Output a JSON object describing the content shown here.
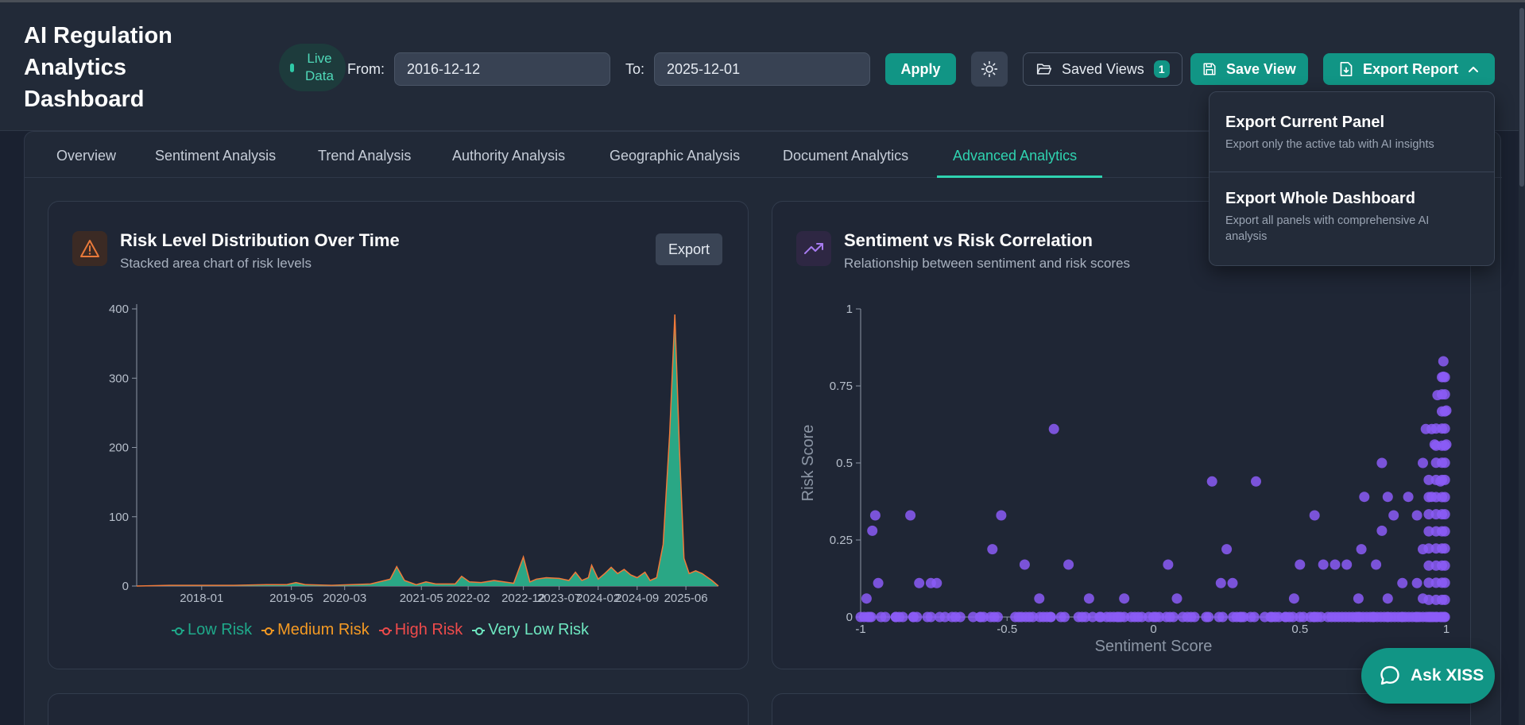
{
  "header": {
    "title": "AI Regulation Analytics Dashboard",
    "live_label": "Live Data",
    "from_label": "From:",
    "from_value": "2016-12-12",
    "to_label": "To:",
    "to_value": "2025-12-01",
    "apply_label": "Apply",
    "saved_views_label": "Saved Views",
    "saved_views_count": "1",
    "save_view_label": "Save View",
    "export_report_label": "Export Report"
  },
  "tabs": [
    {
      "label": "Overview"
    },
    {
      "label": "Sentiment Analysis"
    },
    {
      "label": "Trend Analysis"
    },
    {
      "label": "Authority Analysis"
    },
    {
      "label": "Geographic Analysis"
    },
    {
      "label": "Document Analytics"
    },
    {
      "label": "Advanced Analytics",
      "active": true
    }
  ],
  "export_menu": {
    "current_title": "Export Current Panel",
    "current_desc": "Export only the active tab with AI insights",
    "whole_title": "Export Whole Dashboard",
    "whole_desc": "Export all panels with comprehensive AI analysis"
  },
  "panels": {
    "risk": {
      "title": "Risk Level Distribution Over Time",
      "subtitle": "Stacked area chart of risk levels",
      "export_label": "Export",
      "icon": "warning-triangle-icon",
      "accent": "#e8793a"
    },
    "sentiment": {
      "title": "Sentiment vs Risk Correlation",
      "subtitle": "Relationship between sentiment and risk scores",
      "icon": "trending-up-icon",
      "accent": "#a77bf0"
    }
  },
  "ask_label": "Ask XISS",
  "colors": {
    "accent": "#119585",
    "low": "#1fa98a",
    "medium": "#f59a23",
    "high": "#ef4b4b",
    "very_low": "#6ee7c0",
    "scatter": "#8b5cf6"
  },
  "chart_data": [
    {
      "type": "area",
      "stacked": true,
      "x_ticks": [
        "2018-01",
        "2019-05",
        "2020-03",
        "2021-05",
        "2022-02",
        "2022-12",
        "2023-07",
        "2024-02",
        "2024-09",
        "2025-06"
      ],
      "y_ticks": [
        "0",
        "100",
        "200",
        "300",
        "400"
      ],
      "ylim": [
        0,
        400
      ],
      "series": [
        {
          "name": "Low Risk",
          "color": "#1fa98a"
        },
        {
          "name": "Medium Risk",
          "color": "#f59a23"
        },
        {
          "name": "High Risk",
          "color": "#ef4b4b"
        },
        {
          "name": "Very Low Risk",
          "color": "#6ee7c0"
        }
      ],
      "total_by_month": [
        [
          2017.0,
          0
        ],
        [
          2017.5,
          1
        ],
        [
          2018.0,
          1
        ],
        [
          2018.5,
          1
        ],
        [
          2019.0,
          2
        ],
        [
          2019.3,
          2
        ],
        [
          2019.45,
          5
        ],
        [
          2019.6,
          2
        ],
        [
          2020.0,
          1
        ],
        [
          2020.3,
          2
        ],
        [
          2020.6,
          3
        ],
        [
          2020.9,
          10
        ],
        [
          2021.0,
          28
        ],
        [
          2021.12,
          8
        ],
        [
          2021.3,
          2
        ],
        [
          2021.45,
          6
        ],
        [
          2021.6,
          3
        ],
        [
          2021.9,
          3
        ],
        [
          2022.0,
          14
        ],
        [
          2022.12,
          6
        ],
        [
          2022.3,
          5
        ],
        [
          2022.5,
          8
        ],
        [
          2022.65,
          6
        ],
        [
          2022.8,
          4
        ],
        [
          2022.95,
          42
        ],
        [
          2023.05,
          6
        ],
        [
          2023.15,
          10
        ],
        [
          2023.3,
          12
        ],
        [
          2023.5,
          11
        ],
        [
          2023.65,
          8
        ],
        [
          2023.75,
          20
        ],
        [
          2023.85,
          8
        ],
        [
          2023.95,
          12
        ],
        [
          2024.0,
          30
        ],
        [
          2024.1,
          10
        ],
        [
          2024.2,
          18
        ],
        [
          2024.3,
          27
        ],
        [
          2024.4,
          18
        ],
        [
          2024.5,
          24
        ],
        [
          2024.6,
          16
        ],
        [
          2024.7,
          12
        ],
        [
          2024.82,
          20
        ],
        [
          2024.9,
          8
        ],
        [
          2025.0,
          12
        ],
        [
          2025.1,
          60
        ],
        [
          2025.2,
          220
        ],
        [
          2025.28,
          392
        ],
        [
          2025.35,
          200
        ],
        [
          2025.42,
          40
        ],
        [
          2025.5,
          18
        ],
        [
          2025.6,
          22
        ],
        [
          2025.7,
          18
        ],
        [
          2025.85,
          8
        ],
        [
          2025.95,
          0
        ]
      ]
    },
    {
      "type": "scatter",
      "xlabel": "Sentiment Score",
      "ylabel": "Risk Score",
      "x_ticks": [
        "-1",
        "-0.5",
        "0",
        "0.5",
        "1"
      ],
      "y_ticks": [
        "0",
        "0.25",
        "0.5",
        "0.75",
        "1"
      ],
      "xlim": [
        -1,
        1
      ],
      "ylim": [
        0,
        1
      ],
      "points": [
        [
          -0.98,
          0.06
        ],
        [
          -0.96,
          0.28
        ],
        [
          -0.95,
          0.33
        ],
        [
          -0.94,
          0.11
        ],
        [
          -0.83,
          0.33
        ],
        [
          -0.8,
          0.11
        ],
        [
          -0.76,
          0.11
        ],
        [
          -0.74,
          0.11
        ],
        [
          -0.55,
          0.22
        ],
        [
          -0.52,
          0.33
        ],
        [
          -0.44,
          0.17
        ],
        [
          -0.39,
          0.06
        ],
        [
          -0.34,
          0.61
        ],
        [
          -0.29,
          0.17
        ],
        [
          -0.22,
          0.06
        ],
        [
          -0.1,
          0.06
        ],
        [
          0.0,
          0.0
        ],
        [
          0.05,
          0.17
        ],
        [
          0.08,
          0.06
        ],
        [
          0.2,
          0.44
        ],
        [
          0.23,
          0.11
        ],
        [
          0.25,
          0.22
        ],
        [
          0.27,
          0.11
        ],
        [
          0.35,
          0.44
        ],
        [
          0.48,
          0.06
        ],
        [
          0.5,
          0.17
        ],
        [
          0.55,
          0.33
        ],
        [
          0.58,
          0.17
        ],
        [
          0.62,
          0.17
        ],
        [
          0.66,
          0.17
        ],
        [
          0.7,
          0.06
        ],
        [
          0.71,
          0.22
        ],
        [
          0.72,
          0.39
        ],
        [
          0.76,
          0.17
        ],
        [
          0.78,
          0.28
        ],
        [
          0.78,
          0.5
        ],
        [
          0.8,
          0.06
        ],
        [
          0.8,
          0.39
        ],
        [
          0.82,
          0.33
        ],
        [
          0.85,
          0.11
        ],
        [
          0.87,
          0.39
        ],
        [
          0.9,
          0.11
        ],
        [
          0.9,
          0.33
        ],
        [
          0.92,
          0.06
        ],
        [
          0.92,
          0.22
        ],
        [
          0.92,
          0.5
        ],
        [
          0.95,
          0.39
        ],
        [
          0.95,
          0.61
        ],
        [
          0.97,
          0.72
        ],
        [
          0.98,
          0.44
        ],
        [
          0.99,
          0.78
        ],
        [
          0.99,
          0.83
        ],
        [
          1.0,
          0.67
        ],
        [
          1.0,
          0.56
        ],
        [
          0.96,
          0.56
        ],
        [
          0.93,
          0.61
        ],
        [
          -0.97,
          0.0
        ],
        [
          -0.93,
          0.0
        ],
        [
          -0.88,
          0.0
        ],
        [
          -0.82,
          0.0
        ],
        [
          -0.73,
          0.0
        ],
        [
          -0.66,
          0.0
        ],
        [
          -0.59,
          0.0
        ],
        [
          -0.45,
          0.0
        ],
        [
          -0.35,
          0.0
        ],
        [
          -0.18,
          0.0
        ],
        [
          -0.12,
          0.0
        ],
        [
          0.1,
          0.0
        ],
        [
          0.18,
          0.0
        ],
        [
          0.3,
          0.0
        ],
        [
          0.4,
          0.0
        ],
        [
          0.45,
          0.0
        ],
        [
          0.55,
          0.0
        ],
        [
          0.62,
          0.0
        ],
        [
          0.7,
          0.0
        ],
        [
          0.75,
          0.0
        ],
        [
          0.8,
          0.0
        ],
        [
          0.85,
          0.0
        ],
        [
          0.9,
          0.0
        ],
        [
          0.95,
          0.0
        ]
      ]
    }
  ]
}
